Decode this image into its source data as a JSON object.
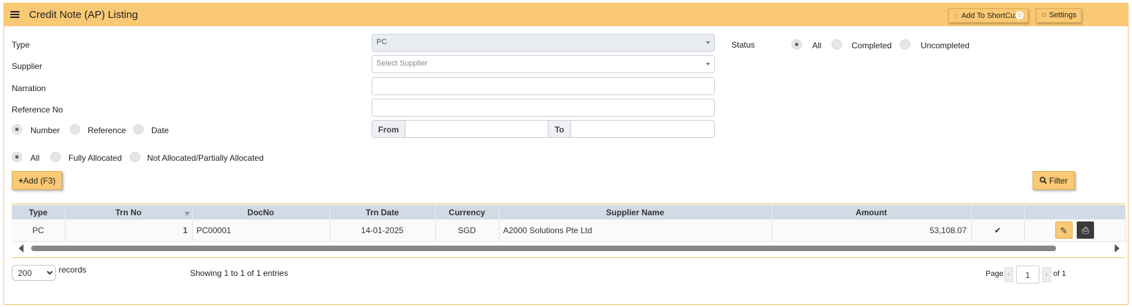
{
  "header": {
    "title": "Credit Note (AP) Listing",
    "shortcut_label": "Add To ShortCut",
    "shortcut_count": "0",
    "settings_label": "Settings"
  },
  "form": {
    "type_label": "Type",
    "type_value": "PC",
    "supplier_label": "Supplier",
    "supplier_placeholder": "Select Supplier",
    "narration_label": "Narration",
    "narration_value": "",
    "reference_label": "Reference No",
    "reference_value": "",
    "status_label": "Status",
    "status_options": [
      "All",
      "Completed",
      "Uncompleted"
    ],
    "range_options": [
      "Number",
      "Reference",
      "Date"
    ],
    "from_label": "From",
    "to_label": "To",
    "from_value": "",
    "to_value": "",
    "allocation_options": [
      "All",
      "Fully Allocated",
      "Not Allocated/Partially Allocated"
    ]
  },
  "buttons": {
    "add_label": "Add (F3)",
    "filter_label": "Filter"
  },
  "table": {
    "columns": [
      "Type",
      "Trn No",
      "DocNo",
      "Trn Date",
      "Currency",
      "Supplier Name",
      "Amount",
      "",
      ""
    ],
    "rows": [
      {
        "type": "PC",
        "trn_no": "1",
        "doc_no": "PC00001",
        "trn_date": "14-01-2025",
        "currency": "SGD",
        "supplier": "A2000 Solutions Pte Ltd",
        "amount": "53,108.07"
      }
    ]
  },
  "footer": {
    "page_size": "200",
    "records_label": "records",
    "showing": "Showing 1 to 1 of 1 entries",
    "page_label": "Page",
    "page_value": "1",
    "of_label": "of 1"
  },
  "icons": {
    "star": "star-icon",
    "gear": "gear-icon",
    "search": "search-icon",
    "check": "check-icon",
    "edit": "edit-icon",
    "print": "print-icon"
  },
  "colors": {
    "accent": "#f9c974",
    "check": "#dd0000",
    "header_row": "#d2dbe5"
  }
}
